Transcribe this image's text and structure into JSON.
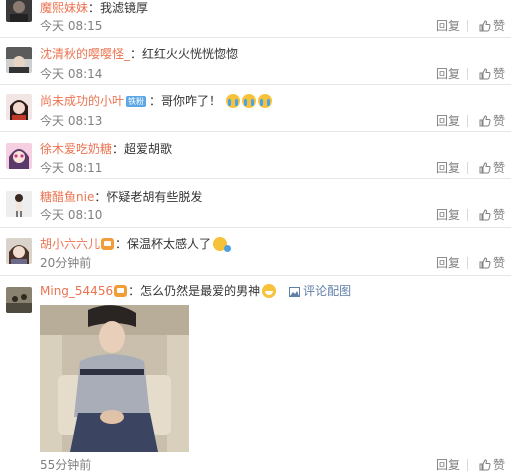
{
  "comments": [
    {
      "user": "魔熙妹妹",
      "text": "：我滤镜厚",
      "time": "今天 08:15",
      "reply": "回复",
      "like": "赞"
    },
    {
      "user": "沈清秋的嘤嘤怪_",
      "text": "：红红火火恍恍惚惚",
      "time": "今天 08:14",
      "reply": "回复",
      "like": "赞"
    },
    {
      "user": "尚未成功的小叶",
      "badge": "铁粉",
      "text": "：哥你咋了！",
      "time": "今天 08:13",
      "reply": "回复",
      "like": "赞",
      "emojis": [
        "cry-emoji",
        "cry-emoji",
        "cry-emoji"
      ]
    },
    {
      "user": "徐木爱吃奶糖",
      "text": "：超爱胡歌",
      "time": "今天 08:11",
      "reply": "回复",
      "like": "赞"
    },
    {
      "user": "糖醋鱼nie",
      "text": "：怀疑老胡有些脱发",
      "time": "今天 08:10",
      "reply": "回复",
      "like": "赞"
    },
    {
      "user": "胡小六六儿",
      "text": "：保温杯太感人了",
      "time": "20分钟前",
      "reply": "回复",
      "like": "赞"
    },
    {
      "user": "Ming_54456",
      "text": "：怎么仍然是最爱的男神",
      "pic_link": "评论配图",
      "time": "55分钟前",
      "reply": "回复",
      "like": "赞"
    }
  ],
  "colors": {
    "username": "#eb7350",
    "meta": "#808080",
    "link": "#5f7fa8",
    "badge": "#5da6e5"
  },
  "icons": {
    "like": "thumbs-up-icon",
    "pic": "image-icon"
  }
}
